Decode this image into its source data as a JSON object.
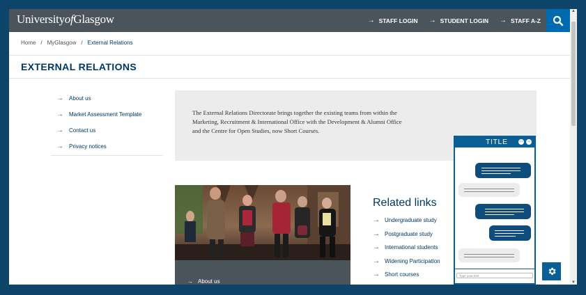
{
  "header": {
    "logo_prefix": "University",
    "logo_of": "of",
    "logo_suffix": "Glasgow",
    "links": [
      "STAFF LOGIN",
      "STUDENT LOGIN",
      "STAFF A-Z"
    ]
  },
  "breadcrumb": {
    "items": [
      "Home",
      "MyGlasgow",
      "External Relations"
    ],
    "separator": "/"
  },
  "page_title": "EXTERNAL RELATIONS",
  "sidenav": {
    "items": [
      "About us",
      "Market Assessment Template",
      "Contact us",
      "Privacy notices"
    ]
  },
  "intro": {
    "text": "The External Relations Directorate brings together the existing teams from within the Marketing, Recruitment & International Office with the Development & Alumni Office and the Centre for Open Studies, now Short Courses."
  },
  "feature": {
    "link": "About us"
  },
  "related": {
    "heading": "Related links",
    "items": [
      "Undergraduate study",
      "Postgraduate study",
      "International students",
      "Widening Participation",
      "Short courses"
    ]
  },
  "chat": {
    "title": "TITLE",
    "input_placeholder": "Type your text"
  },
  "icons": {
    "arrow": "→",
    "search": "search-icon",
    "settings": "gear-icon"
  },
  "colors": {
    "navy": "#003865",
    "topbar": "#4b535b",
    "accent_blue": "#006ab0",
    "chat_blue": "#0b5f97",
    "outer_frame": "#0e4469"
  }
}
